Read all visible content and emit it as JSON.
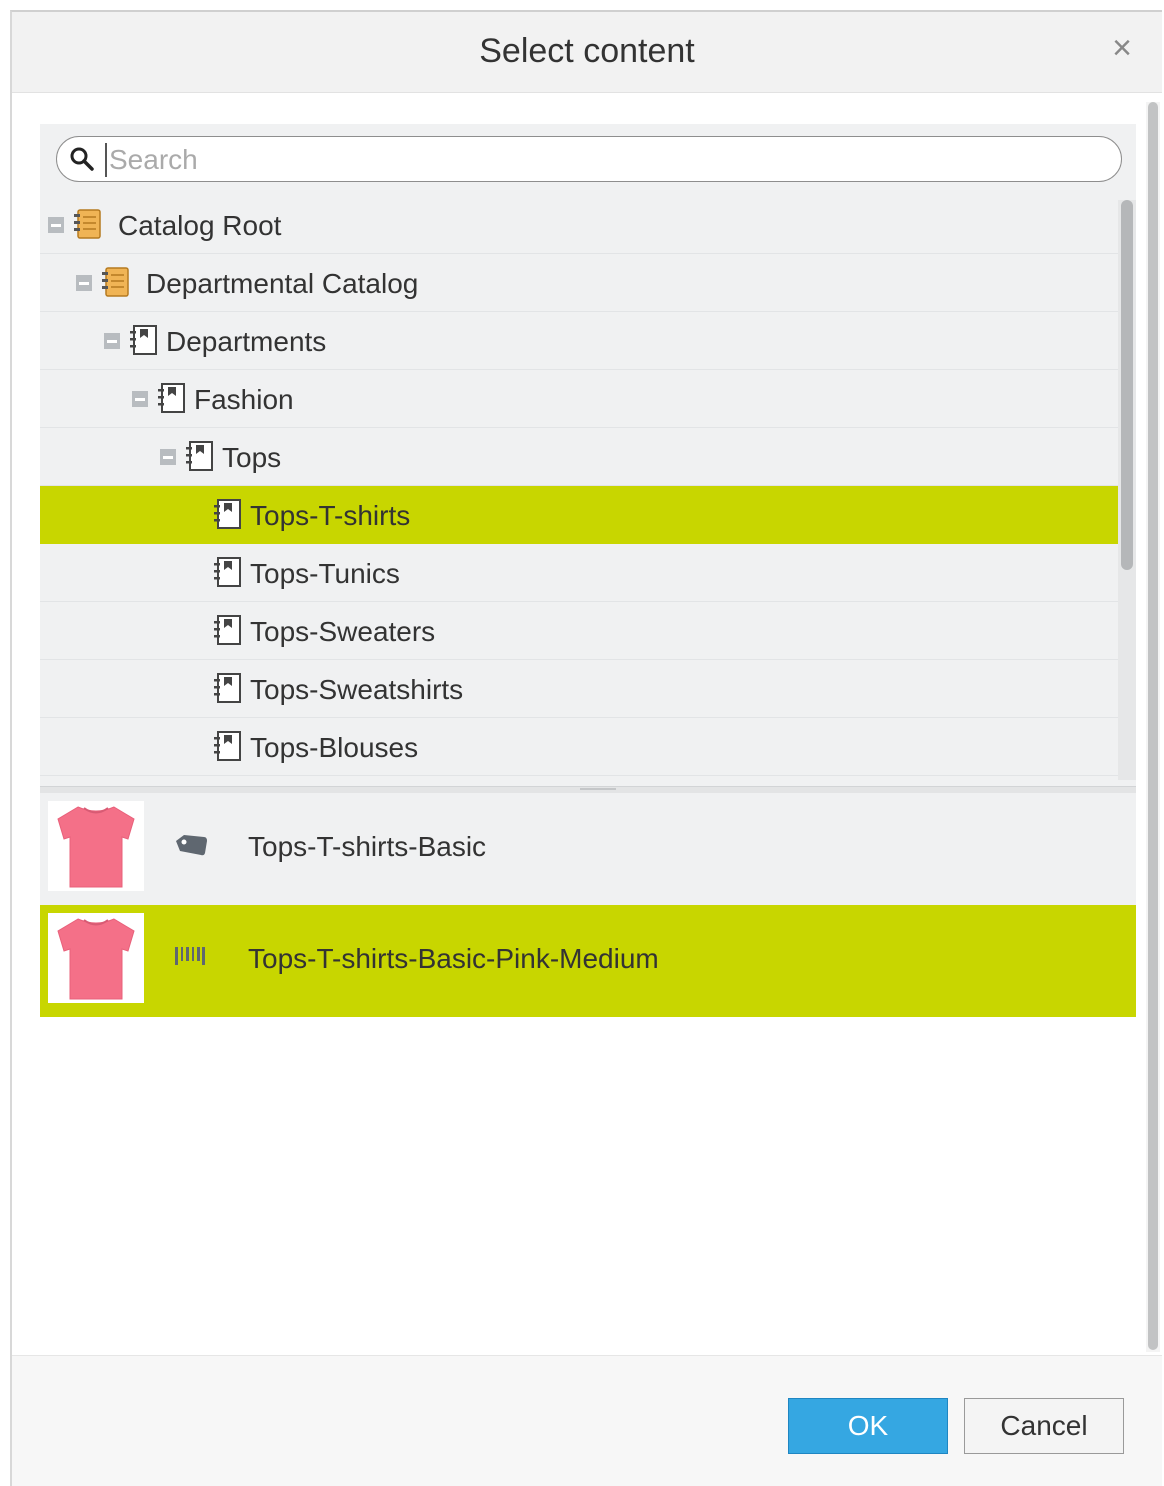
{
  "dialog": {
    "title": "Select content",
    "close_symbol": "×"
  },
  "search": {
    "placeholder": "Search",
    "value": ""
  },
  "tree": {
    "nodes": [
      {
        "label": "Catalog Root",
        "level": 0,
        "expanded": true,
        "icon": "catalog-icon",
        "selected": false
      },
      {
        "label": "Departmental Catalog",
        "level": 1,
        "expanded": true,
        "icon": "catalog-icon",
        "selected": false
      },
      {
        "label": "Departments",
        "level": 2,
        "expanded": true,
        "icon": "category-icon",
        "selected": false
      },
      {
        "label": "Fashion",
        "level": 3,
        "expanded": true,
        "icon": "category-icon",
        "selected": false
      },
      {
        "label": "Tops",
        "level": 4,
        "expanded": true,
        "icon": "category-icon",
        "selected": false
      },
      {
        "label": "Tops-T-shirts",
        "level": 5,
        "expanded": null,
        "icon": "category-icon",
        "selected": true
      },
      {
        "label": "Tops-Tunics",
        "level": 5,
        "expanded": null,
        "icon": "category-icon",
        "selected": false
      },
      {
        "label": "Tops-Sweaters",
        "level": 5,
        "expanded": null,
        "icon": "category-icon",
        "selected": false
      },
      {
        "label": "Tops-Sweatshirts",
        "level": 5,
        "expanded": null,
        "icon": "category-icon",
        "selected": false
      },
      {
        "label": "Tops-Blouses",
        "level": 5,
        "expanded": null,
        "icon": "category-icon",
        "selected": false
      }
    ]
  },
  "results": [
    {
      "label": "Tops-T-shirts-Basic",
      "type_icon": "product-tag-icon",
      "thumbnail": "pink-tshirt",
      "selected": false
    },
    {
      "label": "Tops-T-shirts-Basic-Pink-Medium",
      "type_icon": "sku-barcode-icon",
      "thumbnail": "pink-tshirt",
      "selected": true
    }
  ],
  "buttons": {
    "ok_label": "OK",
    "cancel_label": "Cancel"
  },
  "colors": {
    "selection": "#c8d600",
    "primary_button": "#35a7e2",
    "panel_bg": "#f0f1f2"
  }
}
